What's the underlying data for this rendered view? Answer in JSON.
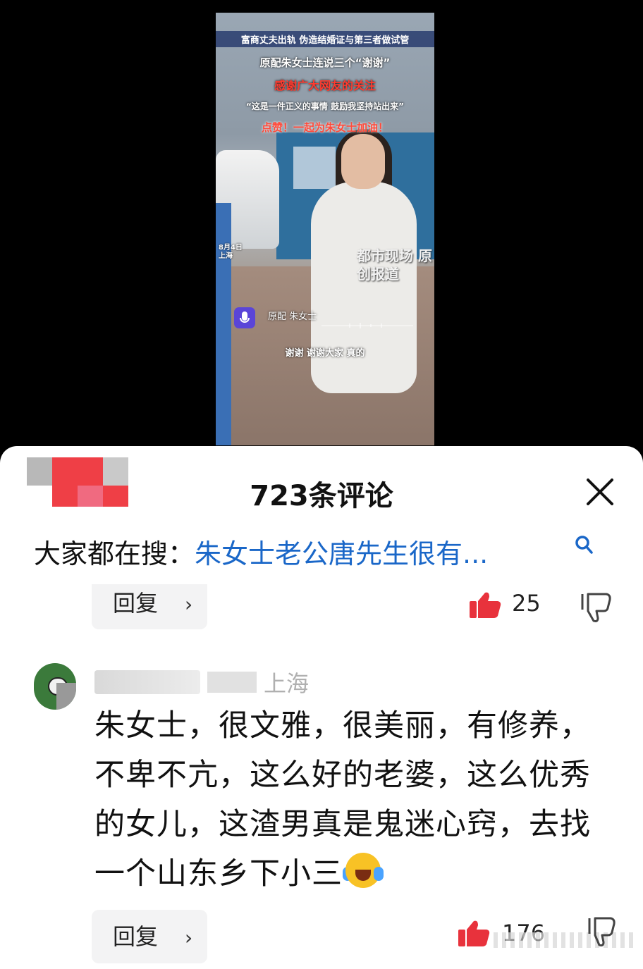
{
  "video": {
    "caption_line1": "富商丈夫出轨 伪造结婚证与第三者做试管",
    "caption_line2": "原配朱女士连说三个“谢谢”",
    "caption_line3": "感谢广大网友的关注",
    "caption_line4": "“这是一件正义的事情 鼓励我坚持站出来”",
    "caption_line5": "点赞！一起为朱女士加油！",
    "date_tag": "8月4日 上海",
    "watermark": "都市现场 原创报道",
    "speaker": "原配 朱女士",
    "subtitle": "谢谢 谢谢大家 真的"
  },
  "comments_panel": {
    "title": "723条评论",
    "close_icon": "close-icon",
    "search_prefix": "大家都在搜：",
    "search_suggestion": "朱女士老公唐先生很有...",
    "search_icon": "search-icon"
  },
  "comment1": {
    "reply_label": "回复",
    "like_count": "25",
    "like_icon": "thumbs-up-icon",
    "dislike_icon": "thumbs-down-icon"
  },
  "comment2": {
    "location": "上海",
    "text": "朱女士，很文雅，很美丽，有修养，不卑不亢，这么好的老婆，这么优秀的女儿，这渣男真是鬼迷心窍，去找一个山东乡下小三",
    "emoji": "laughing-crying-emoji",
    "reply_label": "回复",
    "like_count": "176",
    "like_icon": "thumbs-up-icon",
    "dislike_icon": "thumbs-down-icon"
  },
  "colors": {
    "accent_link": "#1a67c8",
    "like_red": "#e8323c",
    "sheet_bg": "#ffffff",
    "backdrop": "#000000"
  }
}
